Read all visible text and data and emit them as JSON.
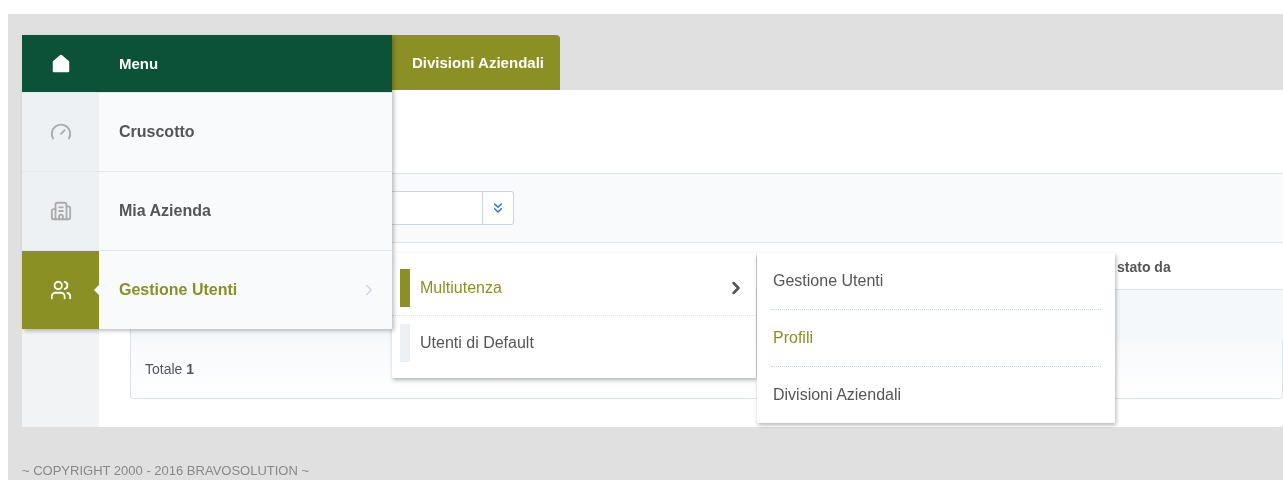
{
  "tab": {
    "label": "Divisioni Aziendali"
  },
  "menu": {
    "title": "Menu",
    "items": [
      {
        "kind": "dashboard",
        "label": "Cruscotto",
        "selected": false,
        "has_submenu": false
      },
      {
        "kind": "company",
        "label": "Mia Azienda",
        "selected": false,
        "has_submenu": false
      },
      {
        "kind": "users",
        "label": "Gestione Utenti",
        "selected": true,
        "has_submenu": true
      }
    ]
  },
  "submenu": {
    "items": [
      {
        "label": "Multiutenza",
        "selected": true,
        "has_submenu": true
      },
      {
        "label": "Utenti di Default",
        "selected": false,
        "has_submenu": false
      }
    ]
  },
  "submenu_2": {
    "items": [
      {
        "label": "Gestione Utenti",
        "selected": false
      },
      {
        "label": "Profili",
        "selected": true
      },
      {
        "label": "Divisioni Aziendali",
        "selected": false
      }
    ]
  },
  "table": {
    "column_header": "stato da",
    "footer": "Totale **1**"
  },
  "copyright": "~ COPYRIGHT 2000 - 2016 BRAVOSOLUTION ~"
}
